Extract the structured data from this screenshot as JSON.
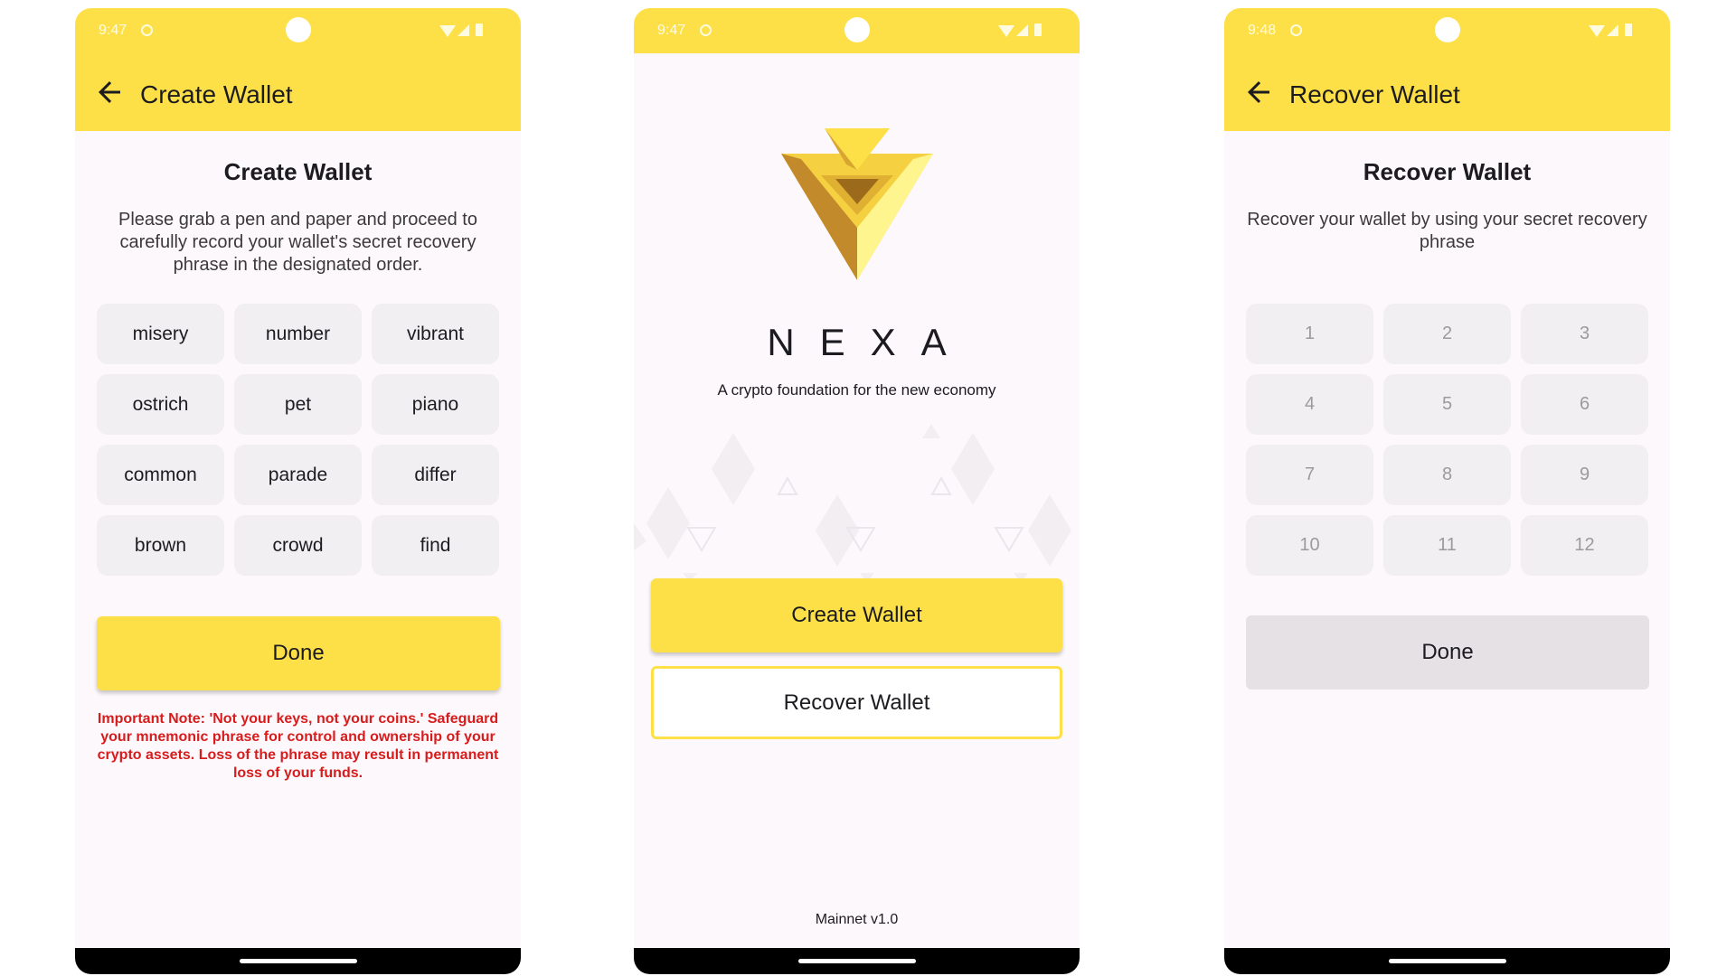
{
  "colors": {
    "accent": "#fde047",
    "warning": "#d71c1c",
    "background": "#fdf8fc"
  },
  "create_screen": {
    "status_time": "9:47",
    "app_bar_title": "Create Wallet",
    "title": "Create Wallet",
    "description": "Please grab a pen and paper and proceed to carefully record your wallet's secret recovery phrase in the designated order.",
    "words": [
      "misery",
      "number",
      "vibrant",
      "ostrich",
      "pet",
      "piano",
      "common",
      "parade",
      "differ",
      "brown",
      "crowd",
      "find"
    ],
    "done_label": "Done",
    "warning": "Important Note: 'Not your keys, not your coins.' Safeguard your mnemonic phrase for control and ownership of your crypto assets. Loss of the phrase may result in permanent loss of your funds.",
    "icons": {
      "back": "arrow-left-icon"
    }
  },
  "home_screen": {
    "status_time": "9:47",
    "brand": "NEXA",
    "tagline": "A crypto foundation for the new economy",
    "create_label": "Create Wallet",
    "recover_label": "Recover Wallet",
    "version": "Mainnet v1.0",
    "icons": {
      "logo": "nexa-logo-icon"
    }
  },
  "recover_screen": {
    "status_time": "9:48",
    "app_bar_title": "Recover Wallet",
    "title": "Recover Wallet",
    "description": "Recover your wallet by using your secret recovery phrase",
    "slots": [
      "1",
      "2",
      "3",
      "4",
      "5",
      "6",
      "7",
      "8",
      "9",
      "10",
      "11",
      "12"
    ],
    "done_label": "Done",
    "icons": {
      "back": "arrow-left-icon"
    }
  }
}
